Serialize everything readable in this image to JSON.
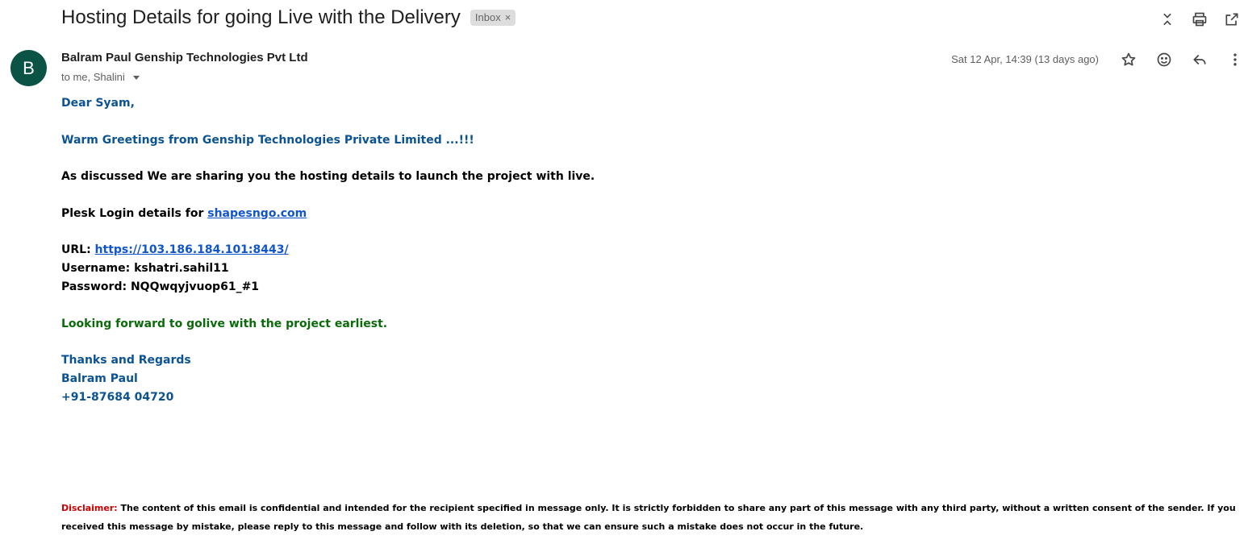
{
  "header": {
    "subject": "Hosting Details for going Live with the Delivery",
    "label": "Inbox",
    "label_remove": "×"
  },
  "toolbar": {
    "icons": [
      "expand-collapse-icon",
      "print-icon",
      "open-in-new-window-icon"
    ]
  },
  "message": {
    "avatar_letter": "B",
    "avatar_color": "#0b5345",
    "sender": "Balram Paul Genship Technologies Pvt Ltd",
    "recipients": "to me, Shalini",
    "date": "Sat 12 Apr, 14:39 (13 days ago)",
    "actions": [
      "star-icon",
      "emoji-reaction-icon",
      "reply-icon",
      "more-options-icon"
    ]
  },
  "body": {
    "greeting": "Dear Syam,",
    "warm": "Warm Greetings from Genship Technologies Private Limited ...!!!",
    "discussed": "As discussed We are sharing you the hosting details to launch the project with live.",
    "plesk_prefix": "Plesk Login details for ",
    "plesk_link": "shapesngo.com",
    "url_prefix": "URL: ",
    "url_link": "https://103.186.184.101:8443/",
    "username": "Username: kshatri.sahil11",
    "password": "Password: NQQwqyjvuop61_#1",
    "looking": "Looking forward to golive with the project earliest.",
    "thanks": "Thanks and Regards",
    "name": "Balram Paul",
    "phone": "+91-87684 04720"
  },
  "disclaimer": {
    "label": "Disclaimer:",
    "text": " The content of this email is confidential and intended for the recipient specified in message only. It is strictly forbidden to share any part of this message with any third party, without a written consent of the sender. If you received this message by mistake, please reply to this message and follow with its deletion, so that we can ensure such a mistake does not occur in the future."
  },
  "colors": {
    "body_blue": "#0b5394",
    "body_green": "#0b6b0b",
    "link": "#1155cc",
    "disclaimer_red": "#cc0000"
  }
}
